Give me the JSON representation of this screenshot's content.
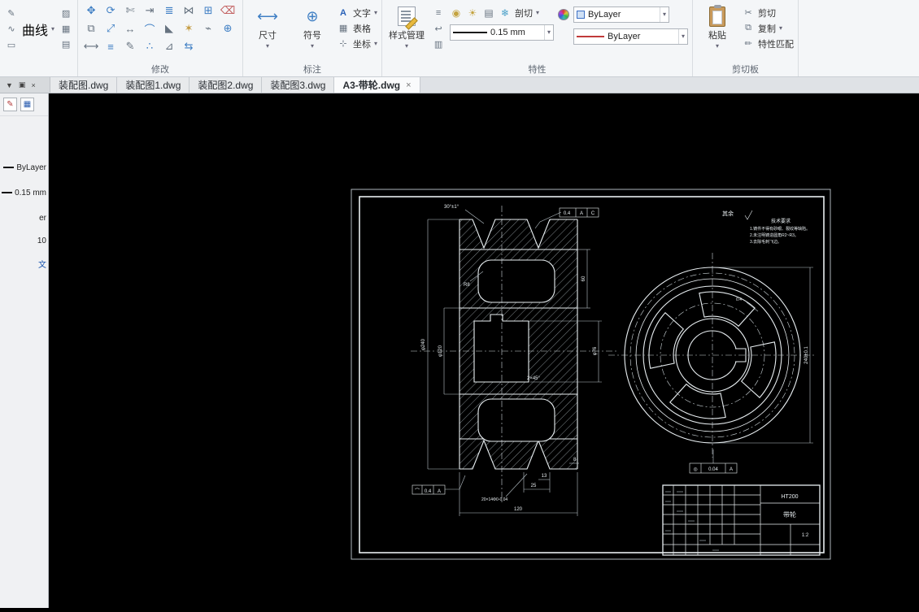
{
  "ribbon": {
    "draw": {
      "curve_label": "曲线"
    },
    "modify": {
      "label": "修改",
      "icons": [
        {
          "name": "move-icon",
          "glyph": "✥",
          "color": "#3f7fc4"
        },
        {
          "name": "rotate-icon",
          "glyph": "⟳",
          "color": "#3f7fc4"
        },
        {
          "name": "trim-icon",
          "glyph": "✄",
          "color": "#66727f"
        },
        {
          "name": "extend-icon",
          "glyph": "⇥",
          "color": "#66727f"
        },
        {
          "name": "offset-icon",
          "glyph": "≣",
          "color": "#3f7fc4"
        },
        {
          "name": "mirror-icon",
          "glyph": "⋈",
          "color": "#66727f"
        },
        {
          "name": "array-icon",
          "glyph": "⊞",
          "color": "#3f7fc4"
        },
        {
          "name": "erase-icon",
          "glyph": "⌫",
          "color": "#bf5757"
        },
        {
          "name": "copy-icon",
          "glyph": "⧉",
          "color": "#66727f"
        },
        {
          "name": "scale-icon",
          "glyph": "⤢",
          "color": "#3f7fc4"
        },
        {
          "name": "stretch-icon",
          "glyph": "↔",
          "color": "#66727f"
        },
        {
          "name": "fillet-icon",
          "glyph": "⌒",
          "color": "#3f7fc4"
        },
        {
          "name": "chamfer-icon",
          "glyph": "◣",
          "color": "#66727f"
        },
        {
          "name": "explode-icon",
          "glyph": "✶",
          "color": "#c49a3f"
        },
        {
          "name": "break-icon",
          "glyph": "⌁",
          "color": "#66727f"
        },
        {
          "name": "join-icon",
          "glyph": "⊕",
          "color": "#3f7fc4"
        },
        {
          "name": "lengthen-icon",
          "glyph": "⟷",
          "color": "#66727f"
        },
        {
          "name": "align-icon",
          "glyph": "≡",
          "color": "#3f7fc4"
        },
        {
          "name": "edit-polyline-icon",
          "glyph": "✎",
          "color": "#66727f"
        },
        {
          "name": "divide-icon",
          "glyph": "∴",
          "color": "#3f7fc4"
        },
        {
          "name": "measure-icon",
          "glyph": "⊿",
          "color": "#66727f"
        },
        {
          "name": "reverse-icon",
          "glyph": "⇆",
          "color": "#3f7fc4"
        }
      ]
    },
    "annotate": {
      "label": "标注",
      "dimension_label": "尺寸",
      "symbol_label": "符号",
      "text_label": "文字",
      "table_label": "表格",
      "coord_label": "坐标"
    },
    "properties": {
      "label": "特性",
      "style_manager_label": "样式管理",
      "section_label": "剖切",
      "lineweight_value": "0.15 mm",
      "color_value": "ByLayer",
      "linetype_value": "ByLayer"
    },
    "clipboard": {
      "label": "剪切板",
      "paste_label": "粘贴",
      "cut_label": "剪切",
      "copy_label": "复制",
      "match_label": "特性匹配"
    }
  },
  "tabbar": {
    "tabs": [
      {
        "label": "装配图.dwg",
        "active": false
      },
      {
        "label": "装配图1.dwg",
        "active": false
      },
      {
        "label": "装配图2.dwg",
        "active": false
      },
      {
        "label": "装配图3.dwg",
        "active": false
      },
      {
        "label": "A3-带轮.dwg",
        "active": true
      }
    ],
    "close_glyph": "×"
  },
  "side_panel": {
    "rows": [
      {
        "swatch": true,
        "text": "ByLayer"
      },
      {
        "swatch": true,
        "text": "0.15 mm"
      },
      {
        "swatch": false,
        "text": "er"
      },
      {
        "swatch": false,
        "text": "10"
      },
      {
        "swatch": false,
        "text": "文",
        "color": "#1a56b0"
      }
    ]
  },
  "drawing": {
    "section": {
      "angle": "30°±1°",
      "flag_top": {
        "value": "0.4",
        "datum1": "A",
        "datum2": "C"
      },
      "radius": "R8",
      "dia_outer": "φ240",
      "dia_hub": "φ120",
      "dia_bore": "φ76",
      "dim_60": "60",
      "chamfer": "2×45°",
      "dim_13": "13",
      "dim_8": "8",
      "dim_25": "25",
      "groove_note": "20×14Φ0-0.04",
      "dim_120": "120",
      "flag_bottom": {
        "sym": "⌒",
        "value": "0.4",
        "datum": "A"
      }
    },
    "front": {
      "dim_240": "240±0.1",
      "flag": "0.4",
      "tol": {
        "sym": "◎",
        "value": "0.04",
        "datum": "A"
      }
    },
    "notes": {
      "other_rough": "其余",
      "title": "技术要求",
      "lines": [
        "1.铸件不得有砂眼、裂纹等缺陷。",
        "2.未注明铸造圆角R2~R3。",
        "3.去除毛刺飞边。"
      ]
    },
    "titleblock": {
      "material": "HT200",
      "part_name": "带轮",
      "scale": "1:2"
    }
  },
  "icons": {
    "dropdown": "▾",
    "menu_down": "▼",
    "pin": "▣",
    "close": "×",
    "cut": "✂",
    "copy": "⧉",
    "match": "✏",
    "text": "A",
    "table": "▦",
    "coord": "⊹",
    "dimension": "⟷",
    "symbol": "⊕",
    "lamp": "◉",
    "sun": "☀",
    "layers": "▤",
    "freeze": "❄",
    "match_layer": "≡",
    "layer_prev": "↩",
    "layer_state": "▥",
    "pencil": "✎",
    "spline": "∿",
    "rect": "▭",
    "hatch": "▨",
    "edit_red": "✎",
    "grid_blue": "▦"
  }
}
